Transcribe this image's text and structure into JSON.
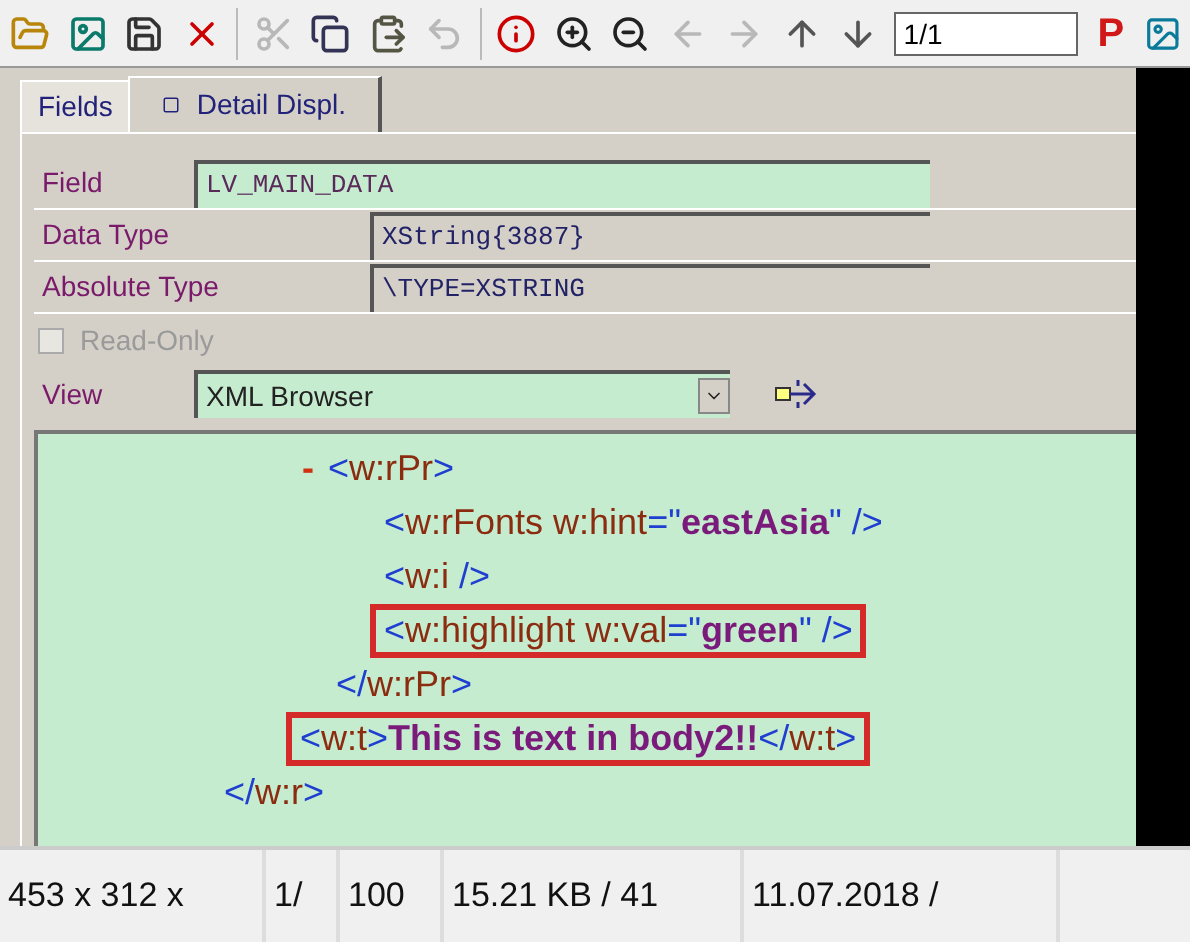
{
  "toolbar": {
    "buttons": [
      {
        "disabled": false
      },
      {
        "disabled": false
      },
      {
        "disabled": false
      },
      {
        "disabled": false
      },
      {
        "disabled": true
      },
      {
        "disabled": false
      },
      {
        "disabled": false
      },
      {
        "disabled": true
      },
      {
        "disabled": false
      },
      {
        "disabled": false
      },
      {
        "disabled": false
      },
      {
        "disabled": true
      },
      {
        "disabled": true
      },
      {
        "disabled": false
      },
      {
        "disabled": false
      }
    ],
    "page_field": "1/1",
    "p_label": "P"
  },
  "tabs": [
    {
      "label": "Fields",
      "selected": false
    },
    {
      "label": "Detail Displ.",
      "selected": true
    }
  ],
  "field": {
    "label": "Field",
    "value": "LV_MAIN_DATA"
  },
  "data_type": {
    "label": "Data Type",
    "value": "XString{3887}"
  },
  "absolute_type": {
    "label": "Absolute Type",
    "value": "\\TYPE=XSTRING"
  },
  "read_only": {
    "label": "Read-Only",
    "checked": false,
    "disabled": true
  },
  "view": {
    "label": "View",
    "value": "XML Browser"
  },
  "xml_view": {
    "nodes": [
      {
        "close": [
          {
            "kind": "punct",
            "text": "</"
          },
          {
            "kind": "name",
            "text": "w:r"
          },
          {
            "kind": "punct",
            "text": ">"
          }
        ],
        "children": [
          {
            "expanded": true,
            "marker": "-",
            "highlighted": false,
            "open": [
              {
                "kind": "punct",
                "text": "<"
              },
              {
                "kind": "name",
                "text": "w:rPr"
              },
              {
                "kind": "punct",
                "text": ">"
              }
            ],
            "close": [
              {
                "kind": "punct",
                "text": "</"
              },
              {
                "kind": "name",
                "text": "w:rPr"
              },
              {
                "kind": "punct",
                "text": ">"
              }
            ],
            "children": [
              {
                "highlighted": false,
                "open": [
                  {
                    "kind": "punct",
                    "text": "<"
                  },
                  {
                    "kind": "name",
                    "text": "w:rFonts w:hint"
                  },
                  {
                    "kind": "punct",
                    "text": "=\""
                  },
                  {
                    "kind": "value",
                    "text": "eastAsia"
                  },
                  {
                    "kind": "punct",
                    "text": "\" />"
                  }
                ]
              },
              {
                "highlighted": false,
                "open": [
                  {
                    "kind": "punct",
                    "text": "<"
                  },
                  {
                    "kind": "name",
                    "text": "w:i"
                  },
                  {
                    "kind": "punct",
                    "text": " />"
                  }
                ]
              },
              {
                "highlighted": true,
                "open": [
                  {
                    "kind": "punct",
                    "text": "<"
                  },
                  {
                    "kind": "name",
                    "text": "w:highlight w:val"
                  },
                  {
                    "kind": "punct",
                    "text": "=\""
                  },
                  {
                    "kind": "value",
                    "text": "green"
                  },
                  {
                    "kind": "punct",
                    "text": "\" />"
                  }
                ]
              }
            ]
          },
          {
            "highlighted": true,
            "open": [
              {
                "kind": "punct",
                "text": "<"
              },
              {
                "kind": "name",
                "text": "w:t"
              },
              {
                "kind": "punct",
                "text": ">"
              },
              {
                "kind": "value",
                "text": "This is text in body2!!"
              },
              {
                "kind": "punct",
                "text": "</"
              },
              {
                "kind": "name",
                "text": "w:t"
              },
              {
                "kind": "punct",
                "text": ">"
              }
            ]
          }
        ]
      }
    ]
  },
  "status_bar": [
    "453 x 312 x",
    "1/",
    "100",
    "15.21 KB / 41",
    "11.07.2018 /"
  ]
}
